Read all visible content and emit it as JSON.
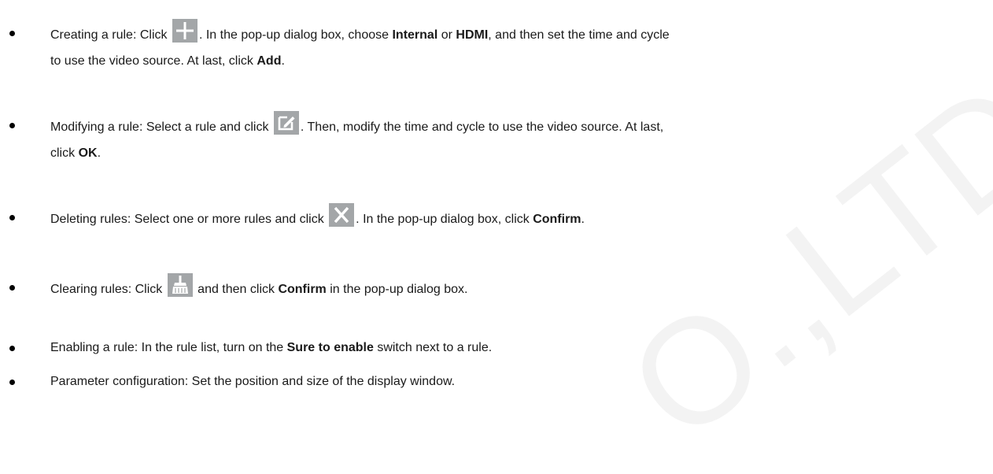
{
  "items": [
    {
      "l1a": "Creating a rule: Click ",
      "l1b": ". In the pop-up dialog box, choose ",
      "b1": "Internal",
      "l1c": " or ",
      "b2": "HDMI",
      "l1d": ", and then set the time and cycle",
      "l2a": "to use the video source. At last, click ",
      "b3": "Add",
      "l2b": "."
    },
    {
      "l1a": "Modifying a rule: Select a rule and click ",
      "l1b": ". Then, modify the time and cycle to use the video source. At last,",
      "l2a": "click ",
      "b1": "OK",
      "l2b": "."
    },
    {
      "l1a": "Deleting rules: Select one or more rules and click ",
      "l1b": ". In the pop-up dialog box, click ",
      "b1": "Confirm",
      "l1c": "."
    },
    {
      "l1a": "Clearing rules: Click ",
      "l1b": " and then click ",
      "b1": "Confirm",
      "l1c": " in the pop-up dialog box."
    },
    {
      "l1a": "Enabling a rule: In the rule list, turn on the ",
      "b1": "Sure to enable",
      "l1b": " switch next to a rule."
    },
    {
      "l1a": "Parameter configuration: Set the position and size of the display window."
    }
  ],
  "icons": {
    "add": "plus-icon",
    "edit": "edit-icon",
    "delete": "close-icon",
    "clear": "broom-icon",
    "icon_bg": "#a3a6a8"
  },
  "watermark": "O.,LTD"
}
